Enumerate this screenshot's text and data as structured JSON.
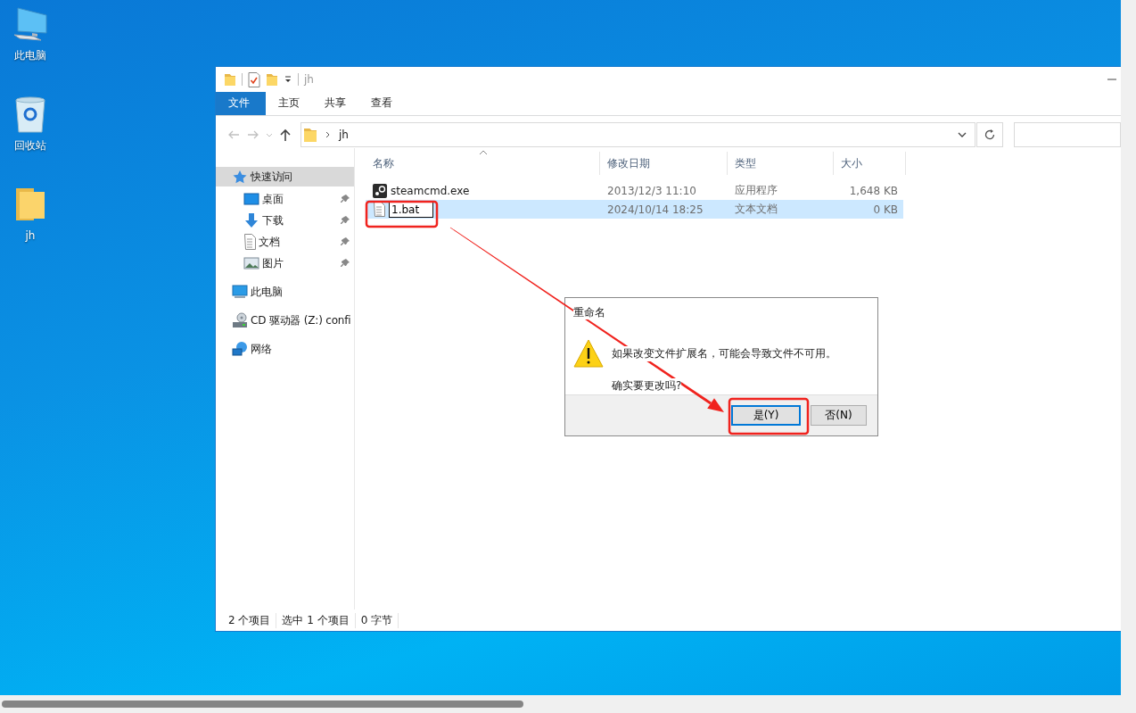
{
  "desktop": {
    "icons": [
      {
        "label": "此电脑",
        "kind": "computer"
      },
      {
        "label": "回收站",
        "kind": "recycle"
      },
      {
        "label": "jh",
        "kind": "folder"
      }
    ]
  },
  "explorer": {
    "title": "jh",
    "ribbon_tabs": [
      {
        "label": "文件",
        "selected": true
      },
      {
        "label": "主页",
        "selected": false
      },
      {
        "label": "共享",
        "selected": false
      },
      {
        "label": "查看",
        "selected": false
      }
    ],
    "address": {
      "path": "jh"
    },
    "nav_items": [
      {
        "label": "快速访问",
        "kind": "star",
        "selected": true,
        "children": [
          {
            "label": "桌面",
            "kind": "desktop",
            "selected": false,
            "pinned": true
          },
          {
            "label": "下载",
            "kind": "download",
            "selected": false,
            "pinned": true
          },
          {
            "label": "文档",
            "kind": "document",
            "selected": false,
            "pinned": true
          },
          {
            "label": "图片",
            "kind": "picture",
            "selected": false,
            "pinned": true
          }
        ]
      },
      {
        "label": "此电脑",
        "kind": "computer",
        "selected": false
      },
      {
        "label": "CD 驱动器 (Z:) confi",
        "kind": "drive",
        "selected": false
      },
      {
        "label": "网络",
        "kind": "network",
        "selected": false
      }
    ],
    "columns": [
      "名称",
      "修改日期",
      "类型",
      "大小"
    ],
    "files": [
      {
        "name": "steamcmd.exe",
        "date": "2013/12/3 11:10",
        "type": "应用程序",
        "size": "1,648 KB",
        "kind": "app",
        "selected": false,
        "renaming": false
      },
      {
        "name": "1.bat",
        "date": "2024/10/14 18:25",
        "type": "文本文档",
        "size": "0 KB",
        "kind": "text",
        "selected": true,
        "renaming": true
      }
    ],
    "status_bar": [
      "2 个项目",
      "选中 1 个项目",
      "0 字节"
    ]
  },
  "dialog": {
    "title": "重命名",
    "message": "如果改变文件扩展名，可能会导致文件不可用。",
    "question": "确实要更改吗?",
    "buttons": [
      {
        "label": "是(Y)",
        "focused": true
      },
      {
        "label": "否(N)",
        "focused": false
      }
    ]
  }
}
